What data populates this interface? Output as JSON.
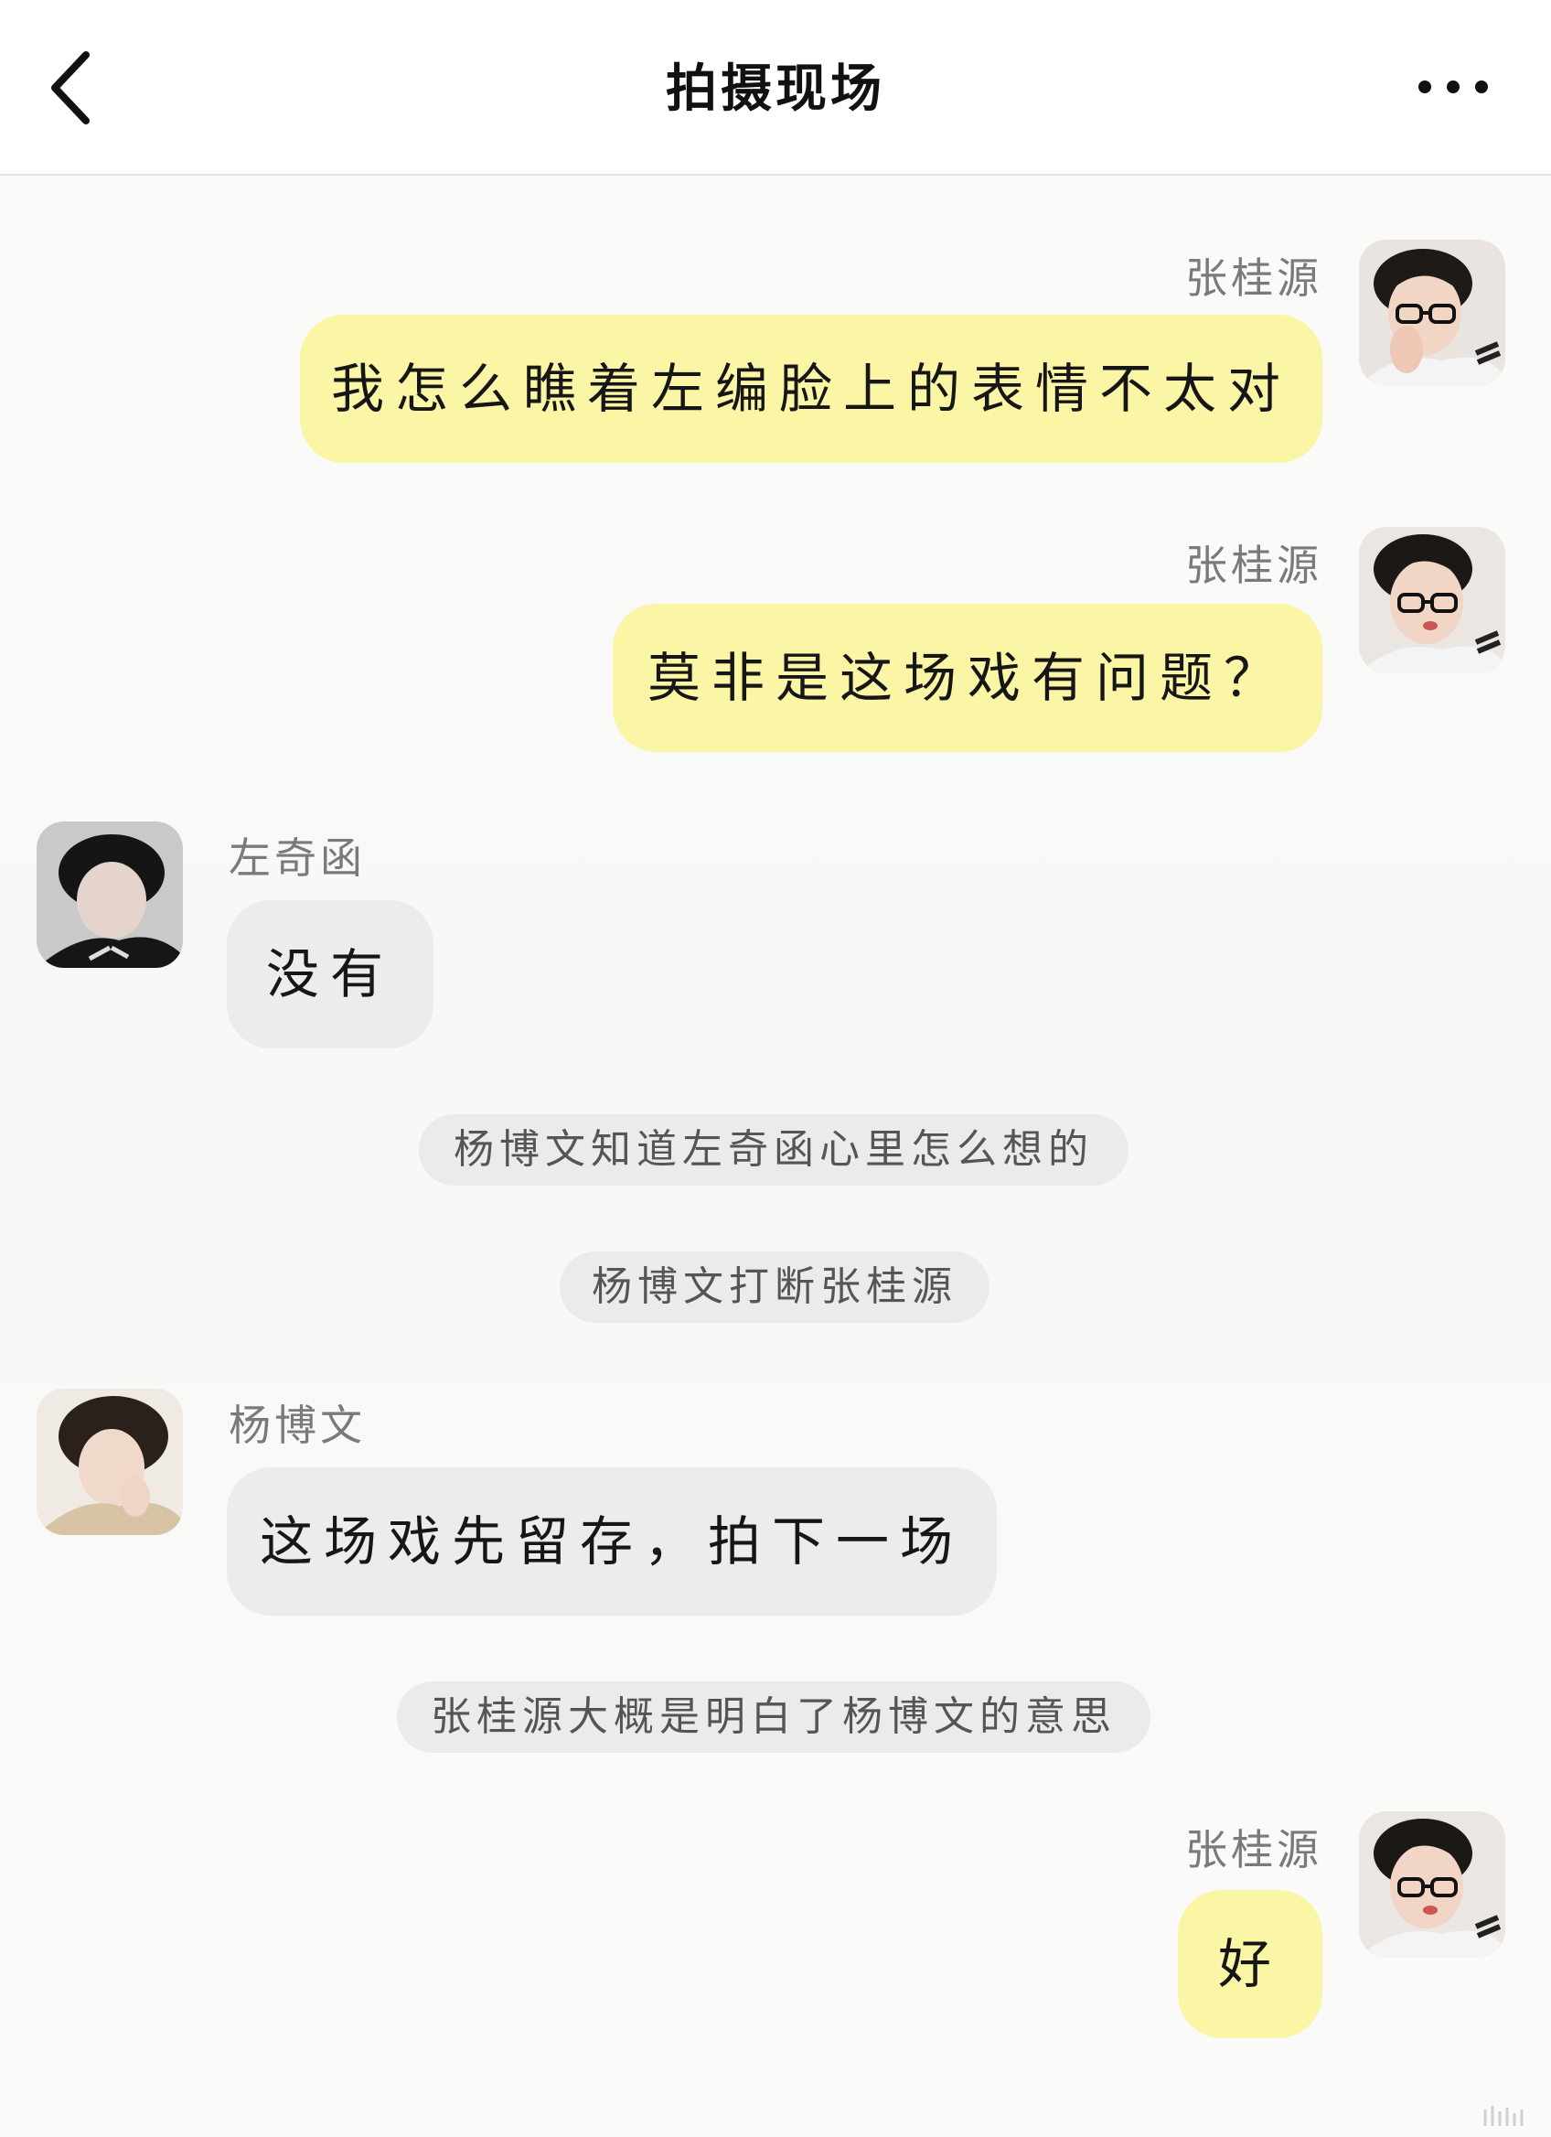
{
  "header": {
    "title": "拍摄现场",
    "back_icon": "chevron-left-icon",
    "more_icon": "more-horizontal-icon"
  },
  "colors": {
    "self_bubble": "#fbf6a6",
    "other_bubble": "#ececec",
    "system_bubble": "#ebebeb"
  },
  "messages": [
    {
      "sender": "张桂源",
      "text": "我怎么瞧着左编脸上的表情不太对"
    },
    {
      "sender": "张桂源",
      "text": "莫非是这场戏有问题？"
    },
    {
      "sender": "左奇函",
      "text": "没有"
    },
    {
      "system": "杨博文知道左奇函心里怎么想的"
    },
    {
      "system": "杨博文打断张桂源"
    },
    {
      "sender": "杨博文",
      "text": "这场戏先留存，拍下一场"
    },
    {
      "system": "张桂源大概是明白了杨博文的意思"
    },
    {
      "sender": "张桂源",
      "text": "好"
    }
  ]
}
